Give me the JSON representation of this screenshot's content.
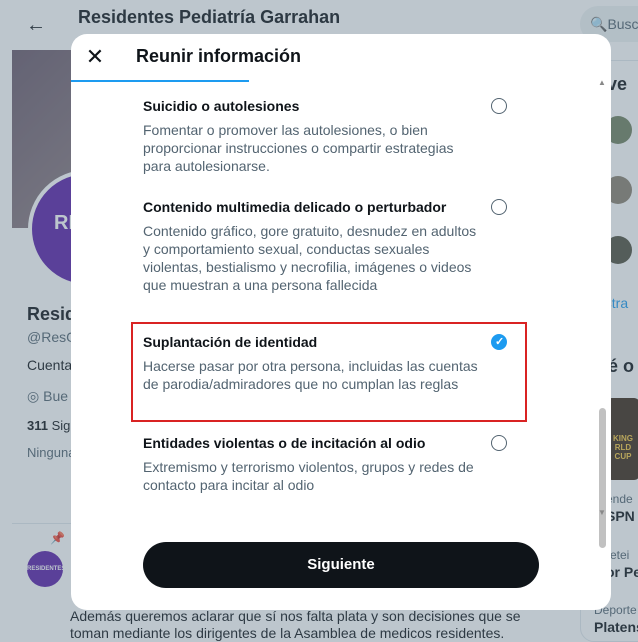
{
  "background": {
    "title": "Residentes Pediatría Garrahan",
    "avatar_text": "RES GA",
    "name": "Resid",
    "handle": "@ResG",
    "bio": "Cuenta",
    "location": "Bue",
    "following_count": "311",
    "following_label": "Sig",
    "followers_none": "Ninguna",
    "avatar_small_text": "RESIDENTES GARRAHAN",
    "tweet_text": "Además queremos aclarar que sí nos falta plata y son decisiones que se toman mediante los dirigentes de la Asamblea de medicos residentes.",
    "search_placeholder": "Busc",
    "right_panel": {
      "heading1": "l ve",
      "show_more": "ostra",
      "heading2": "ué o",
      "trend_img_text": "KING RLD CUP",
      "trend1_small": "ende",
      "trend1": "SPN",
      "trend2_small": "retei",
      "trend2": "or Pe",
      "trend3_small": "Deporte",
      "trend3": "Platens"
    }
  },
  "modal": {
    "title": "Reunir información",
    "close_label": "✕",
    "options": [
      {
        "title": "Suicidio o autolesiones",
        "description": "Fomentar o promover las autolesiones, o bien proporcionar instrucciones o compartir estrategias para autolesionarse.",
        "selected": false
      },
      {
        "title": "Contenido multimedia delicado o perturbador",
        "description": "Contenido gráfico, gore gratuito, desnudez en adultos y comportamiento sexual, conductas sexuales violentas, bestialismo y necrofilia, imágenes o videos que muestran a una persona fallecida",
        "selected": false
      },
      {
        "title": "Suplantación de identidad",
        "description": "Hacerse pasar por otra persona, incluidas las cuentas de parodia/admiradores que no cumplan las reglas",
        "selected": true
      },
      {
        "title": "Entidades violentas o de incitación al odio",
        "description": "Extremismo y terrorismo violentos, grupos y redes de contacto para incitar al odio",
        "selected": false
      }
    ],
    "next_label": "Siguiente"
  }
}
